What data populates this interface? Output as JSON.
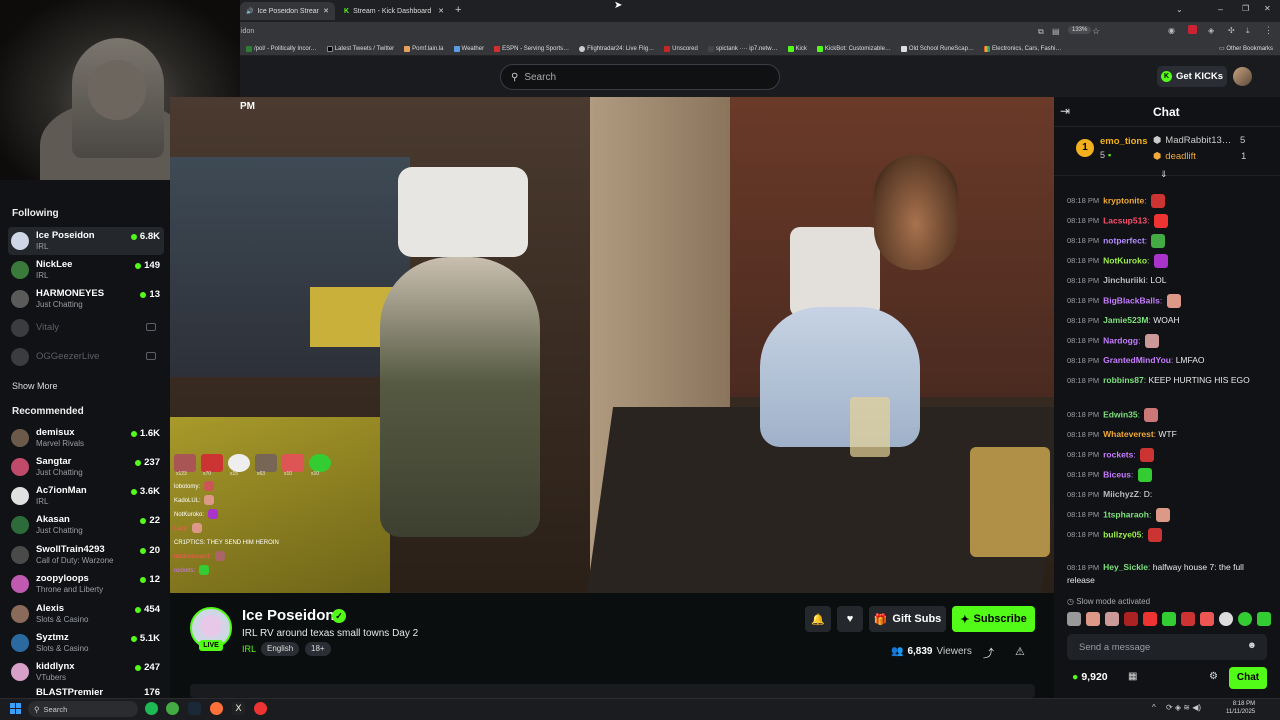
{
  "browser": {
    "tabs": [
      {
        "label": "Ice Poseidon Stream - Wat…",
        "active": true
      },
      {
        "label": "Stream - Kick Dashboard",
        "active": false
      }
    ],
    "new_tab": "+",
    "address_fragment": "idon",
    "zoom": "133%",
    "bookmarks": [
      "/pol/ - Politically Incor…",
      "Latest Tweets / Twitter",
      "Pomf.lain.la",
      "Weather",
      "ESPN - Serving Sports…",
      "Flightradar24: Live Flig…",
      "Unscored",
      "spictank ···· ip7.netw…",
      "Kick",
      "KickBot: Customizable…",
      "Old School RuneScap…",
      "Electronics, Cars, Fashi…"
    ],
    "other_bookmarks": "Other Bookmarks"
  },
  "header": {
    "search_placeholder": "Search",
    "get_kicks": "Get KICKs"
  },
  "sidebar": {
    "following_title": "Following",
    "following": [
      {
        "name": "Ice Poseidon",
        "category": "IRL",
        "viewers": "6.8K",
        "selected": true
      },
      {
        "name": "NickLee",
        "category": "IRL",
        "viewers": "149"
      },
      {
        "name": "HARMONEYES",
        "category": "Just Chatting",
        "viewers": "13"
      },
      {
        "name": "Vitaly",
        "offline": true
      },
      {
        "name": "OGGeezerLive",
        "offline": true
      }
    ],
    "show_more": "Show More",
    "recommended_title": "Recommended",
    "recommended": [
      {
        "name": "demisux",
        "category": "Marvel Rivals",
        "viewers": "1.6K"
      },
      {
        "name": "Sangtar",
        "category": "Just Chatting",
        "viewers": "237"
      },
      {
        "name": "Ac7ionMan",
        "category": "IRL",
        "viewers": "3.6K"
      },
      {
        "name": "Akasan",
        "category": "Just Chatting",
        "viewers": "22"
      },
      {
        "name": "SwollTrain4293",
        "category": "Call of Duty: Warzone",
        "viewers": "20"
      },
      {
        "name": "zoopyloops",
        "category": "Throne and Liberty",
        "viewers": "12"
      },
      {
        "name": "Alexis",
        "category": "Slots & Casino",
        "viewers": "454"
      },
      {
        "name": "Syztmz",
        "category": "Slots & Casino",
        "viewers": "5.1K"
      },
      {
        "name": "kiddlynx",
        "category": "VTubers",
        "viewers": "247"
      },
      {
        "name": "BLASTPremier",
        "category": "",
        "viewers": "176"
      }
    ]
  },
  "video": {
    "overlay_clock": "PM",
    "overlay_chat": [
      {
        "user": "lobotomy:"
      },
      {
        "user": "KadoLUL:"
      },
      {
        "user": "NotKuroko:"
      },
      {
        "user": "Lacy:"
      },
      {
        "user": "CR1PTICS:",
        "text": "THEY SEND HIM HEROIN"
      },
      {
        "user": "tracksonsaint:"
      },
      {
        "user": "rockets:"
      }
    ],
    "overlay_counts": [
      "x123",
      "x70",
      "x15",
      "x63",
      "x10",
      "x10"
    ]
  },
  "stream": {
    "channel": "Ice Poseidon",
    "live": "LIVE",
    "title": "IRL RV around texas small towns Day 2",
    "category": "IRL",
    "tags": [
      "English",
      "18+"
    ],
    "gift_subs": "Gift Subs",
    "subscribe": "Subscribe",
    "viewers_count": "6,839",
    "viewers_label": "Viewers"
  },
  "chat": {
    "title": "Chat",
    "leaderboard": [
      {
        "rank": "1",
        "user": "emo_tions",
        "amount": "5"
      },
      {
        "user": "MadRabbit13…",
        "amount": "5"
      },
      {
        "user": "deadlift",
        "amount": "1"
      }
    ],
    "messages": [
      {
        "time": "08:18 PM",
        "user": "kryptonite",
        "color": "#f2a93b",
        "text": ""
      },
      {
        "time": "08:18 PM",
        "user": "Lacsup513",
        "color": "#ff4f6d",
        "text": ""
      },
      {
        "time": "08:18 PM",
        "user": "notperfect",
        "color": "#b58cff",
        "text": ""
      },
      {
        "time": "08:18 PM",
        "user": "NotKuroko",
        "color": "#9ef04d",
        "text": ""
      },
      {
        "time": "08:18 PM",
        "user": "Jinchuriiki",
        "color": "#bbbbbb",
        "text": "LOL"
      },
      {
        "time": "08:18 PM",
        "user": "BigBlackBalls",
        "color": "#c77dff",
        "text": ""
      },
      {
        "time": "08:18 PM",
        "user": "Jamie523M",
        "color": "#7ee07e",
        "text": "WOAH"
      },
      {
        "time": "08:18 PM",
        "user": "Nardogg",
        "color": "#c77dff",
        "text": ""
      },
      {
        "time": "08:18 PM",
        "user": "GrantedMindYou",
        "color": "#c77dff",
        "text": "LMFAO"
      },
      {
        "time": "08:18 PM",
        "user": "robbins87",
        "color": "#7ee07e",
        "text": "KEEP HURTING HIS EGO"
      },
      {
        "time": "08:18 PM",
        "user": "Edwin35",
        "color": "#7ee07e",
        "text": ""
      },
      {
        "time": "08:18 PM",
        "user": "Whateverest",
        "color": "#f2a93b",
        "text": "WTF"
      },
      {
        "time": "08:18 PM",
        "user": "rockets",
        "color": "#c77dff",
        "text": ""
      },
      {
        "time": "08:18 PM",
        "user": "Biceus",
        "color": "#c77dff",
        "text": ""
      },
      {
        "time": "08:18 PM",
        "user": "MiichyzZ",
        "color": "#bbbbbb",
        "text": "D:"
      },
      {
        "time": "08:18 PM",
        "user": "1tspharaoh",
        "color": "#7ee07e",
        "text": ""
      },
      {
        "time": "08:18 PM",
        "user": "bullzye05",
        "color": "#9ef04d",
        "text": ""
      },
      {
        "time": "08:18 PM",
        "user": "Hey_Sickle",
        "color": "#7ee07e",
        "text": "halfway house 7: the full release"
      }
    ],
    "slow_mode": "Slow mode activated",
    "send_placeholder": "Send a message",
    "kicks_balance": "9,920",
    "chat_button": "Chat"
  },
  "taskbar": {
    "search": "Search",
    "time": "8:18 PM",
    "date": "11/11/2025"
  }
}
